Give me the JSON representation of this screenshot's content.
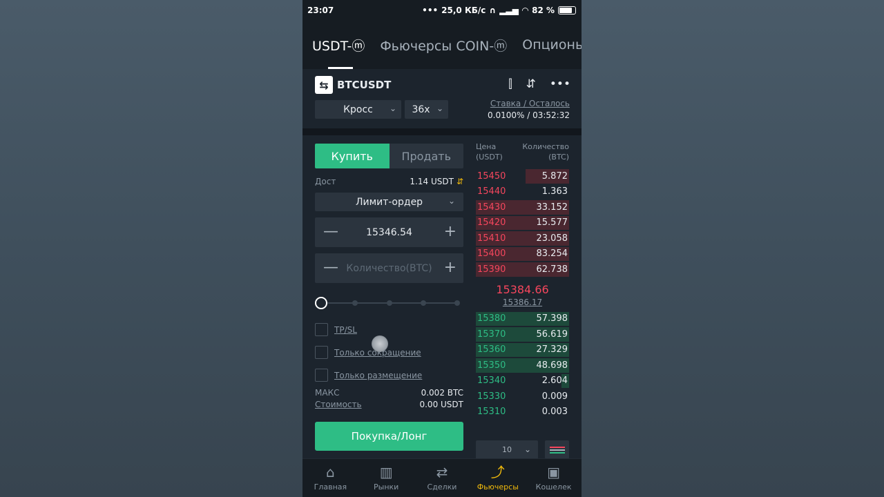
{
  "status": {
    "time": "23:07",
    "dots": "•••",
    "net": "25,0 КБ/с",
    "battery": "82 %",
    "battery_level": 0.82
  },
  "tabs": [
    "USDT-ⓜ",
    "Фьючерсы COIN-ⓜ",
    "Опционы"
  ],
  "header": {
    "symbol": "BTCUSDT",
    "margin_mode": "Кросс",
    "leverage": "36x",
    "rate_label": "Ставка / Осталось",
    "rate_value": "0.0100% / 03:52:32"
  },
  "order": {
    "buy": "Купить",
    "sell": "Продать",
    "avail_label": "Дост",
    "avail_value": "1.14 USDT",
    "order_type": "Лимит-ордер",
    "price": "15346.54",
    "qty_placeholder": "Количество(BTC)",
    "tpsl": "TP/SL",
    "reduce_only": "Только сокращение",
    "post_only": "Только размещение",
    "max_label": "МАКС",
    "max_value": "0.002 BTC",
    "cost_label": "Стоимость",
    "cost_value": "0.00 USDT",
    "long_button": "Покупка/Лонг"
  },
  "book": {
    "price_header": "Цена (USDT)",
    "qty_header": "Количество (BTC)",
    "asks": [
      {
        "p": "15450",
        "q": "5.872",
        "fill": 0.47
      },
      {
        "p": "15440",
        "q": "1.363",
        "fill": 0
      },
      {
        "p": "15430",
        "q": "33.152",
        "fill": 1
      },
      {
        "p": "15420",
        "q": "15.577",
        "fill": 1
      },
      {
        "p": "15410",
        "q": "23.058",
        "fill": 1
      },
      {
        "p": "15400",
        "q": "83.254",
        "fill": 1
      },
      {
        "p": "15390",
        "q": "62.738",
        "fill": 1
      }
    ],
    "last": "15384.66",
    "mark": "15386.17",
    "bids": [
      {
        "p": "15380",
        "q": "57.398",
        "fill": 1
      },
      {
        "p": "15370",
        "q": "56.619",
        "fill": 1
      },
      {
        "p": "15360",
        "q": "27.329",
        "fill": 1
      },
      {
        "p": "15350",
        "q": "48.698",
        "fill": 1
      },
      {
        "p": "15340",
        "q": "2.604",
        "fill": 0.08
      },
      {
        "p": "15330",
        "q": "0.009",
        "fill": 0
      },
      {
        "p": "15310",
        "q": "0.003",
        "fill": 0
      }
    ],
    "depth": "10"
  },
  "nav": [
    {
      "label": "Главная",
      "icon": "home-icon",
      "glyph": "⌂"
    },
    {
      "label": "Рынки",
      "icon": "markets-icon",
      "glyph": "▥"
    },
    {
      "label": "Сделки",
      "icon": "trades-icon",
      "glyph": "⇄"
    },
    {
      "label": "Фьючерсы",
      "icon": "futures-icon",
      "glyph": "⤴"
    },
    {
      "label": "Кошелек",
      "icon": "wallet-icon",
      "glyph": "▣"
    }
  ],
  "colors": {
    "buy": "#2ebd85",
    "sell": "#f6465d",
    "accent": "#f0b90b"
  }
}
